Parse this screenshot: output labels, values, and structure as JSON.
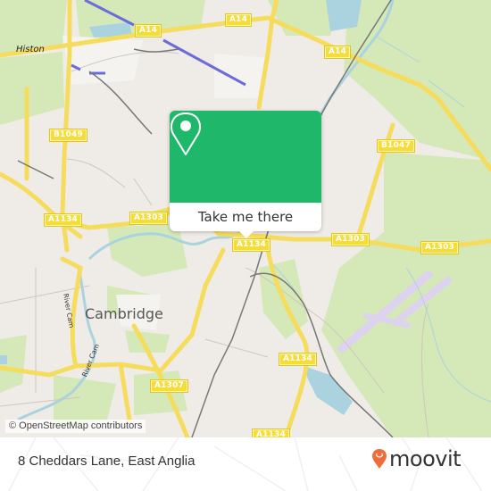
{
  "map": {
    "place_labels": {
      "histon": "Histon",
      "cambridge": "Cambridge",
      "river_cam_1": "River Cam",
      "river_cam_2": "River Cam"
    },
    "road_labels": [
      {
        "id": "a14-west",
        "text": "A14"
      },
      {
        "id": "a14-east",
        "text": "A14"
      },
      {
        "id": "a14-northeast",
        "text": "A14"
      },
      {
        "id": "b1049",
        "text": "B1049"
      },
      {
        "id": "b1047",
        "text": "B1047"
      },
      {
        "id": "a1134-west",
        "text": "A1134"
      },
      {
        "id": "a1303-center",
        "text": "A1303"
      },
      {
        "id": "a1134-center",
        "text": "A1134"
      },
      {
        "id": "a1303-east1",
        "text": "A1303"
      },
      {
        "id": "a1303-east2",
        "text": "A1303"
      },
      {
        "id": "a1134-south",
        "text": "A1134"
      },
      {
        "id": "a1307",
        "text": "A1307"
      },
      {
        "id": "a1134-bottom",
        "text": "A1134"
      }
    ],
    "attribution": "© OpenStreetMap contributors",
    "colors": {
      "land": "#efebe7",
      "park": "#cfe6b0",
      "water": "#aad3df",
      "road": "#f6dc5c",
      "rail": "#777777",
      "runway": "#ddd2ef"
    }
  },
  "popup": {
    "icon": "map-pin-icon",
    "button_label": "Take me there",
    "accent": "#1fb86b"
  },
  "footer": {
    "address": "8 Cheddars Lane, East Anglia",
    "brand": "moovit",
    "brand_color": "#f26b3a"
  }
}
